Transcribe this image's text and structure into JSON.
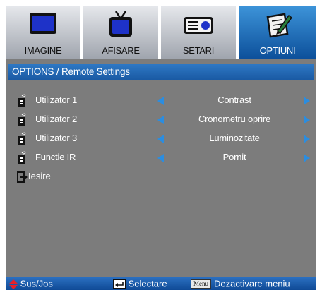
{
  "tabs": [
    {
      "label": "IMAGINE",
      "icon": "monitor-icon",
      "active": false
    },
    {
      "label": "AFISARE",
      "icon": "tv-icon",
      "active": false
    },
    {
      "label": "SETARI",
      "icon": "projector-icon",
      "active": false
    },
    {
      "label": "OPTIUNI",
      "icon": "notepad-pencil-icon",
      "active": true
    }
  ],
  "section": {
    "title": "OPTIONS / Remote Settings"
  },
  "rows": [
    {
      "label": "Utilizator 1",
      "value": "Contrast",
      "icon": "remote-icon"
    },
    {
      "label": "Utilizator 2",
      "value": "Cronometru oprire",
      "icon": "remote-icon"
    },
    {
      "label": "Utilizator 3",
      "value": "Luminozitate",
      "icon": "remote-icon"
    },
    {
      "label": "Functie IR",
      "value": "Pornit",
      "icon": "remote-icon"
    }
  ],
  "exit": {
    "label": "Iesire",
    "icon": "exit-icon"
  },
  "footer": {
    "nav": "Sus/Jos",
    "select": "Selectare",
    "menu_key": "Menu",
    "menu_action": "Dezactivare meniu"
  },
  "colors": {
    "active_tab": "#1c6cc0",
    "section_header": "#2466b4",
    "panel": "#7c7c7c",
    "arrow": "#2b8de0",
    "footer": "#1d5ca8"
  }
}
